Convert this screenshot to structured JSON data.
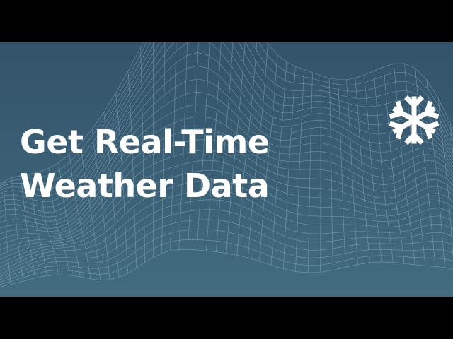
{
  "headline": {
    "line1": "Get Real-Time",
    "line2": "Weather Data"
  },
  "logo": {
    "icon": "snowflake-icon",
    "color": "#ffffff"
  },
  "colors": {
    "background_top": "#33536a",
    "background_bottom": "#436c80",
    "letterbox": "#000000",
    "mesh": "#a9c6d4",
    "text": "#ffffff"
  }
}
